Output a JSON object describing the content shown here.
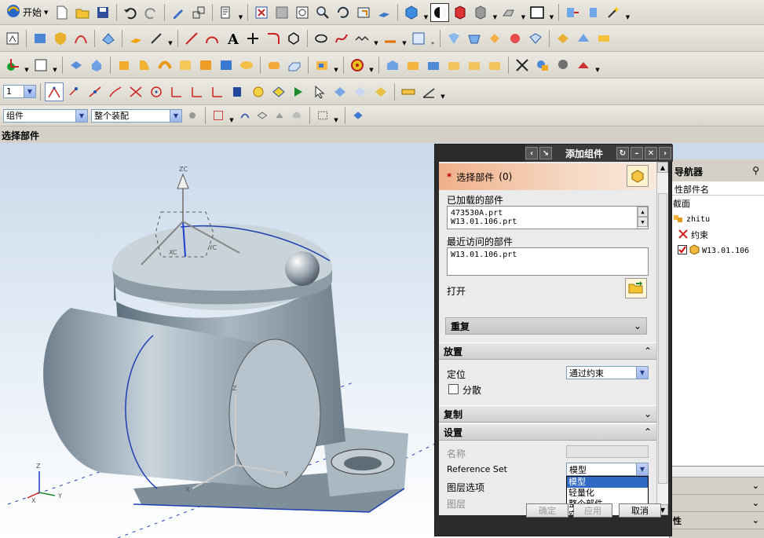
{
  "toolbar": {
    "start_label": "开始",
    "layer_combo_value": "1",
    "filter_combo_value": "组件",
    "assembly_combo_value": "整个装配"
  },
  "status": {
    "prompt": "选择部件"
  },
  "viewport": {
    "wcs_x": "X",
    "wcs_y": "Y",
    "wcs_z": "Z",
    "csys_xc": "XC",
    "csys_yc": "YC",
    "csys_zc": "ZC",
    "triad_x": "X",
    "triad_y": "Y",
    "triad_z": "Z"
  },
  "navigator": {
    "title": "导航器",
    "column": "性部件名",
    "rows": [
      "截面",
      "zhitu",
      "约束",
      "W13.01.106"
    ],
    "bottom_label": "性"
  },
  "dialog": {
    "title": "添加组件",
    "select_part_label": "选择部件",
    "select_part_count": "(0)",
    "loaded_parts_label": "已加载的部件",
    "loaded_parts": [
      "473530A.prt",
      "W13.01.106.prt"
    ],
    "recent_parts_label": "最近访问的部件",
    "recent_parts": [
      "W13.01.106.prt"
    ],
    "open_label": "打开",
    "repeat_label": "重复",
    "placement_section": "放置",
    "positioning_label": "定位",
    "positioning_value": "通过约束",
    "scatter_label": "分散",
    "copy_section": "复制",
    "settings_section": "设置",
    "name_label": "名称",
    "reference_set_label": "Reference Set",
    "reference_set_value": "模型",
    "reference_set_options": [
      "模型",
      "轻量化",
      "整个部件",
      "空"
    ],
    "layer_option_label": "图层选项",
    "layer_label": "图层",
    "ok_label": "确定",
    "apply_label": "应用",
    "cancel_label": "取消"
  }
}
